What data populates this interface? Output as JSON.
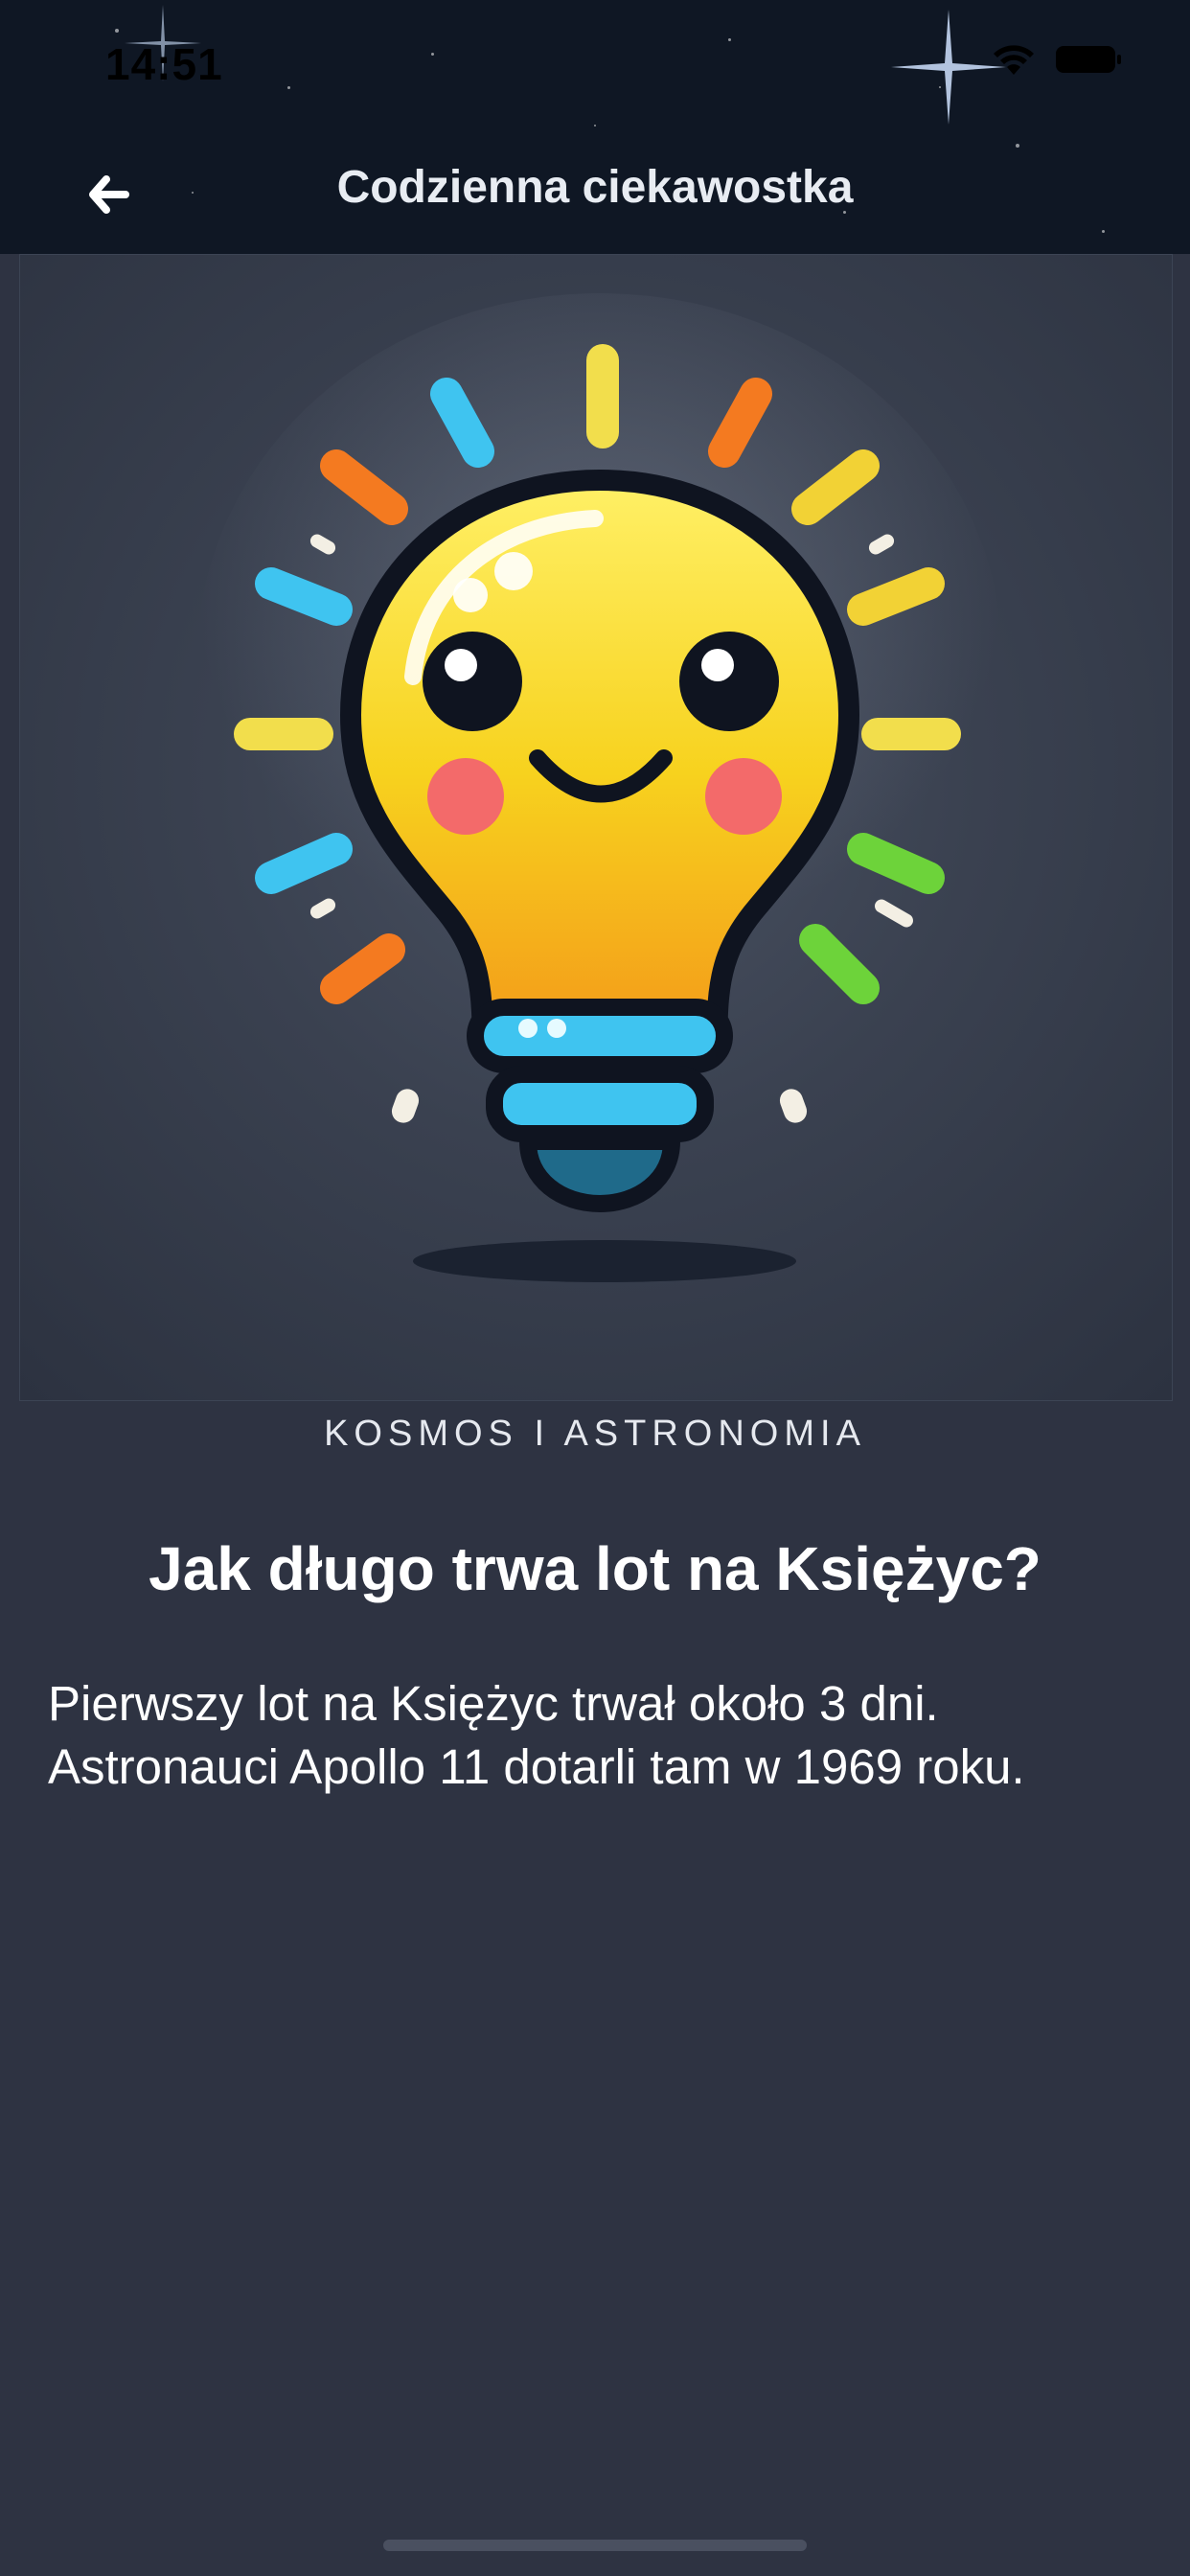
{
  "status_bar": {
    "time": "14:51"
  },
  "header": {
    "title": "Codzienna ciekawostka",
    "back_icon": "arrow-left-icon"
  },
  "hero": {
    "image": "lightbulb-mascot-illustration"
  },
  "article": {
    "category": "KOSMOS I ASTRONOMIA",
    "title": "Jak długo trwa lot na Księżyc?",
    "line1": "Pierwszy lot na Księżyc trwał około 3 dni.",
    "line2": "Astronauci Apollo 11 dotarli tam w 1969 roku."
  },
  "colors": {
    "background": "#2e3342",
    "header_background": "#0f1724",
    "bulb_yellow": "#f7d21e",
    "bulb_orange": "#f4a01a",
    "bulb_base": "#3fc4f0"
  }
}
